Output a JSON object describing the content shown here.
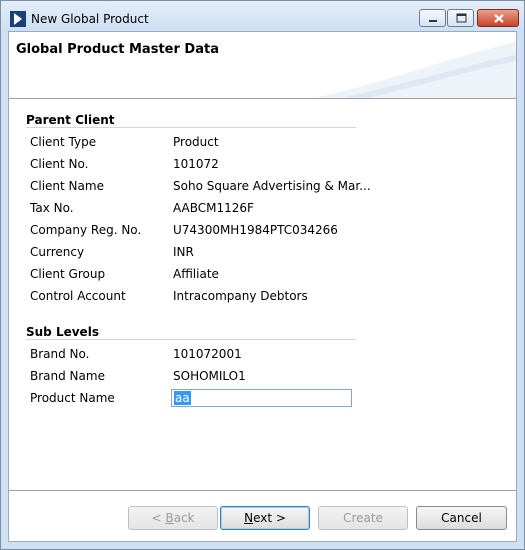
{
  "window": {
    "title": "New Global Product"
  },
  "header": {
    "title": "Global Product Master Data"
  },
  "parent_client": {
    "section_title": "Parent Client",
    "fields": [
      {
        "label": "Client Type",
        "value": "Product"
      },
      {
        "label": "Client No.",
        "value": "101072"
      },
      {
        "label": "Client Name",
        "value": "Soho Square Advertising & Mar..."
      },
      {
        "label": "Tax No.",
        "value": "AABCM1126F"
      },
      {
        "label": "Company Reg. No.",
        "value": "U74300MH1984PTC034266"
      },
      {
        "label": "Currency",
        "value": "INR"
      },
      {
        "label": "Client Group",
        "value": "Affiliate"
      },
      {
        "label": "Control Account",
        "value": "Intracompany Debtors"
      }
    ]
  },
  "sub_levels": {
    "section_title": "Sub Levels",
    "fields": [
      {
        "label": "Brand No.",
        "value": "101072001"
      },
      {
        "label": "Brand Name",
        "value": "SOHOMILO1"
      }
    ],
    "product_name": {
      "label": "Product Name",
      "value": "aa"
    }
  },
  "buttons": {
    "back": {
      "prefix": "< ",
      "mnemonic": "B",
      "rest": "ack"
    },
    "next": {
      "mnemonic": "N",
      "rest": "ext >"
    },
    "create": "Create",
    "cancel": "Cancel"
  },
  "colors": {
    "title_bar": "#cddff3",
    "selection": "#3399ff",
    "close_button": "#c7432a"
  },
  "icons": [
    "app-icon",
    "minimize-icon",
    "maximize-icon",
    "close-icon"
  ]
}
